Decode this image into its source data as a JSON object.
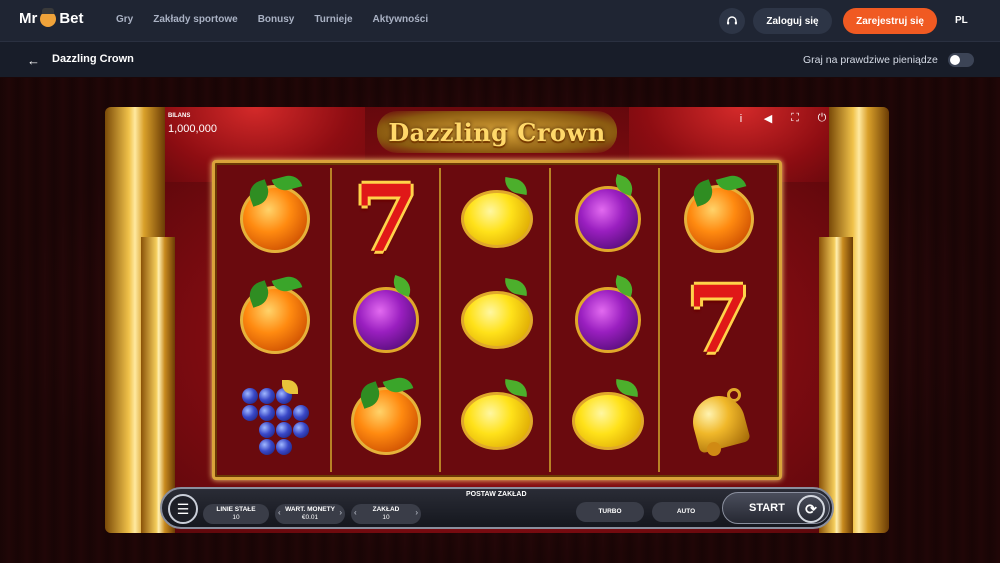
{
  "topnav": {
    "logo": {
      "left": "Mr",
      "right": "Bet"
    },
    "links": [
      "Gry",
      "Zakłady sportowe",
      "Bonusy",
      "Turnieje",
      "Aktywności"
    ],
    "login_label": "Zaloguj się",
    "register_label": "Zarejestruj się",
    "language": "PL"
  },
  "subbar": {
    "title": "Dazzling Crown",
    "real_money_label": "Graj na prawdziwe pieniądze",
    "real_money_enabled": false
  },
  "game": {
    "title": "Dazzling Crown",
    "balance_label": "BILANS",
    "balance_value": "1,000,000",
    "top_icons": [
      "info-icon",
      "sound-icon",
      "fullscreen-icon",
      "power-icon"
    ],
    "reels": [
      [
        "orange",
        "orange",
        "grapes"
      ],
      [
        "seven",
        "plum",
        "orange"
      ],
      [
        "lemon",
        "lemon",
        "lemon"
      ],
      [
        "plum",
        "plum",
        "lemon"
      ],
      [
        "orange",
        "seven",
        "bell"
      ]
    ],
    "controls": {
      "bet_header": "POSTAW ZAKŁAD",
      "lines_label": "LINIE STAŁE",
      "lines_value": "10",
      "coin_label": "WART. MONETY",
      "coin_value": "€0.01",
      "bet_label": "ZAKŁAD",
      "bet_value": "10",
      "turbo_label": "TURBO",
      "auto_label": "AUTO",
      "start_label": "START"
    }
  },
  "colors": {
    "nav_bg": "#1f2533",
    "register_accent": "#f05a22",
    "gold": "#d9a33a"
  }
}
